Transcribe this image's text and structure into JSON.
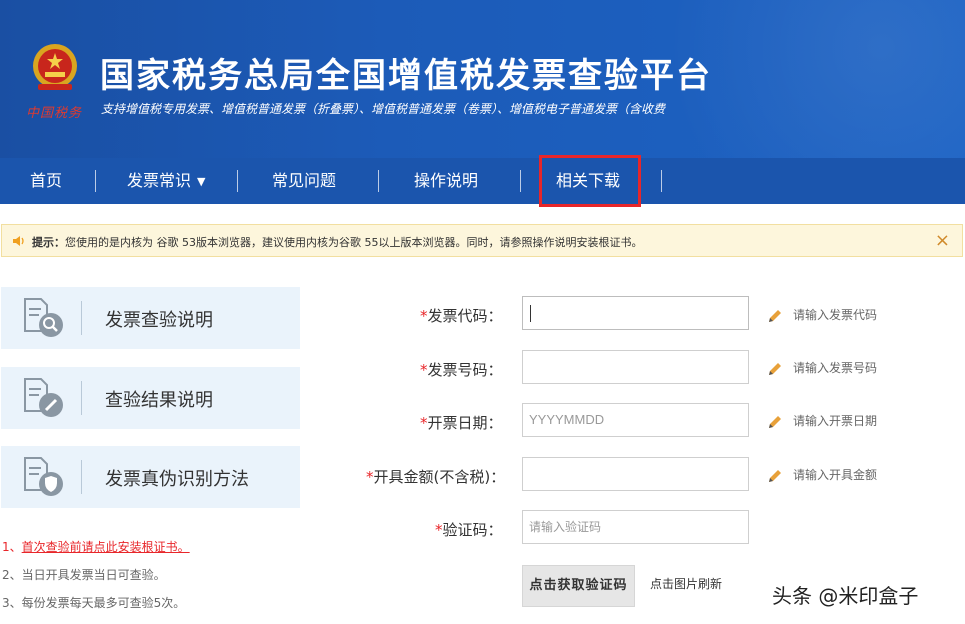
{
  "header": {
    "title": "国家税务总局全国增值税发票查验平台",
    "subtitle": "支持增值税专用发票、增值税普通发票（折叠票）、增值税普通发票（卷票）、增值税电子普通发票（含收费",
    "emblem_caption": "中国税务"
  },
  "nav": {
    "items": [
      {
        "label": "首页"
      },
      {
        "label": "发票常识"
      },
      {
        "label": "常见问题"
      },
      {
        "label": "操作说明"
      },
      {
        "label": "相关下载"
      }
    ],
    "highlighted": "相关下载"
  },
  "notice": {
    "prefix": "提示：",
    "text": "您使用的是内核为 谷歌 53版本浏览器，建议使用内核为谷歌 55以上版本浏览器。同时，请参照操作说明安装根证书。",
    "close": "×"
  },
  "cards": [
    {
      "label": "发票查验说明",
      "icon": "search-document-icon"
    },
    {
      "label": "查验结果说明",
      "icon": "edit-document-icon"
    },
    {
      "label": "发票真伪识别方法",
      "icon": "shield-document-icon"
    }
  ],
  "tips": {
    "tip1_prefix": "1、",
    "tip1_text": "首次查验前请点此安装根证书。",
    "tip2": "2、当日开具发票当日可查验。",
    "tip3": "3、每份发票每天最多可查验5次。"
  },
  "form": {
    "invoice_code": {
      "label": "发票代码：",
      "value": "",
      "hint": "请输入发票代码"
    },
    "invoice_number": {
      "label": "发票号码：",
      "value": "",
      "hint": "请输入发票号码"
    },
    "issue_date": {
      "label": "开票日期：",
      "placeholder": "YYYYMMDD",
      "hint": "请输入开票日期"
    },
    "amount": {
      "label": "开具金额(不含税)：",
      "value": "",
      "hint": "请输入开具金额"
    },
    "captcha": {
      "label": "验证码：",
      "placeholder": "请输入验证码"
    },
    "required_mark": "*",
    "captcha_button": "点击获取验证码",
    "refresh_text": "点击图片刷新"
  },
  "watermark": "头条 @米印盒子",
  "colors": {
    "header_blue": "#1c5bb8",
    "nav_blue": "#1b55ad",
    "highlight_red": "#e8262a",
    "card_bg": "#eaf3fb",
    "notice_bg": "#fdf6dc"
  }
}
